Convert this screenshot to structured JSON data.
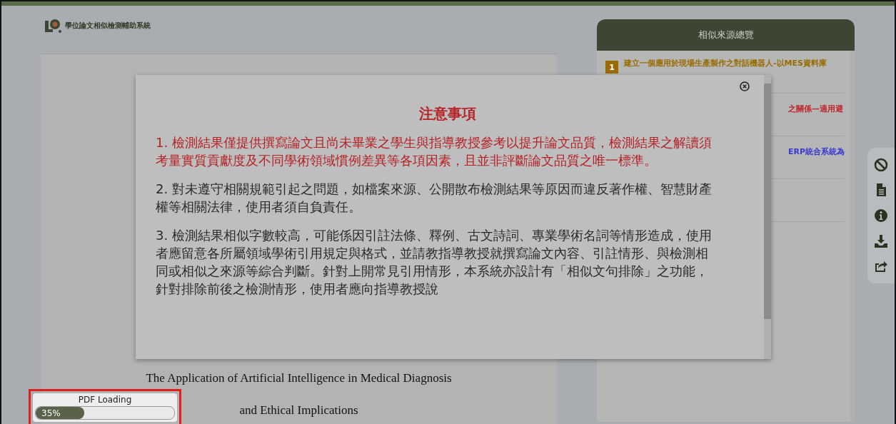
{
  "app": {
    "title": "學位論文相似檢測輔助系統"
  },
  "document": {
    "lines": [
      "The Application of Artificial Intelligence in Medical Diagnosis",
      "and Ethical Implications"
    ]
  },
  "sources_panel": {
    "title": "相似來源總覽",
    "items": [
      {
        "rank": "1",
        "title": "建立一個應用於現場生產製作之對話機器人-以MES資料庫",
        "color": "#9a6c00"
      },
      {
        "title": "之關係—適用避",
        "color": "#c0262c"
      },
      {
        "title": "ERP統合系統為",
        "color": "#3b3bd0"
      }
    ]
  },
  "toolbar": [
    {
      "kind": "exclude"
    },
    {
      "kind": "report"
    },
    {
      "kind": "info"
    },
    {
      "kind": "download"
    },
    {
      "kind": "share"
    }
  ],
  "notice_dialog": {
    "title": "注意事項",
    "paragraphs": [
      {
        "kind": "warning",
        "number": "1.",
        "text": "檢測結果僅提供撰寫論文且尚未畢業之學生與指導教授參考以提升論文品質，檢測結果之解讀須考量實質貢獻度及不同學術領域慣例差異等各項因素，且並非評斷論文品質之唯一標準。"
      },
      {
        "kind": "normal",
        "number": "2.",
        "text": "對未遵守相關規範引起之問題，如檔案來源、公開散布檢測結果等原因而違反著作權、智慧財產權等相關法律，使用者須自負責任。"
      },
      {
        "kind": "normal",
        "number": "3.",
        "text": "檢測結果相似字數較高，可能係因引註法條、釋例、古文詩詞、專業學術名詞等情形造成，使用者應留意各所屬領域學術引用規定與格式，並請教指導教授就撰寫論文內容、引註情形、與檢測相同或相似之來源等綜合判斷。針對上開常見引用情形，本系統亦設計有「相似文句排除」之功能，針對排除前後之檢測情形，使用者應向指導教授說"
      }
    ]
  },
  "loading": {
    "label": "PDF Loading",
    "reading": "35%",
    "level": 0.35,
    "highlighted": true
  }
}
